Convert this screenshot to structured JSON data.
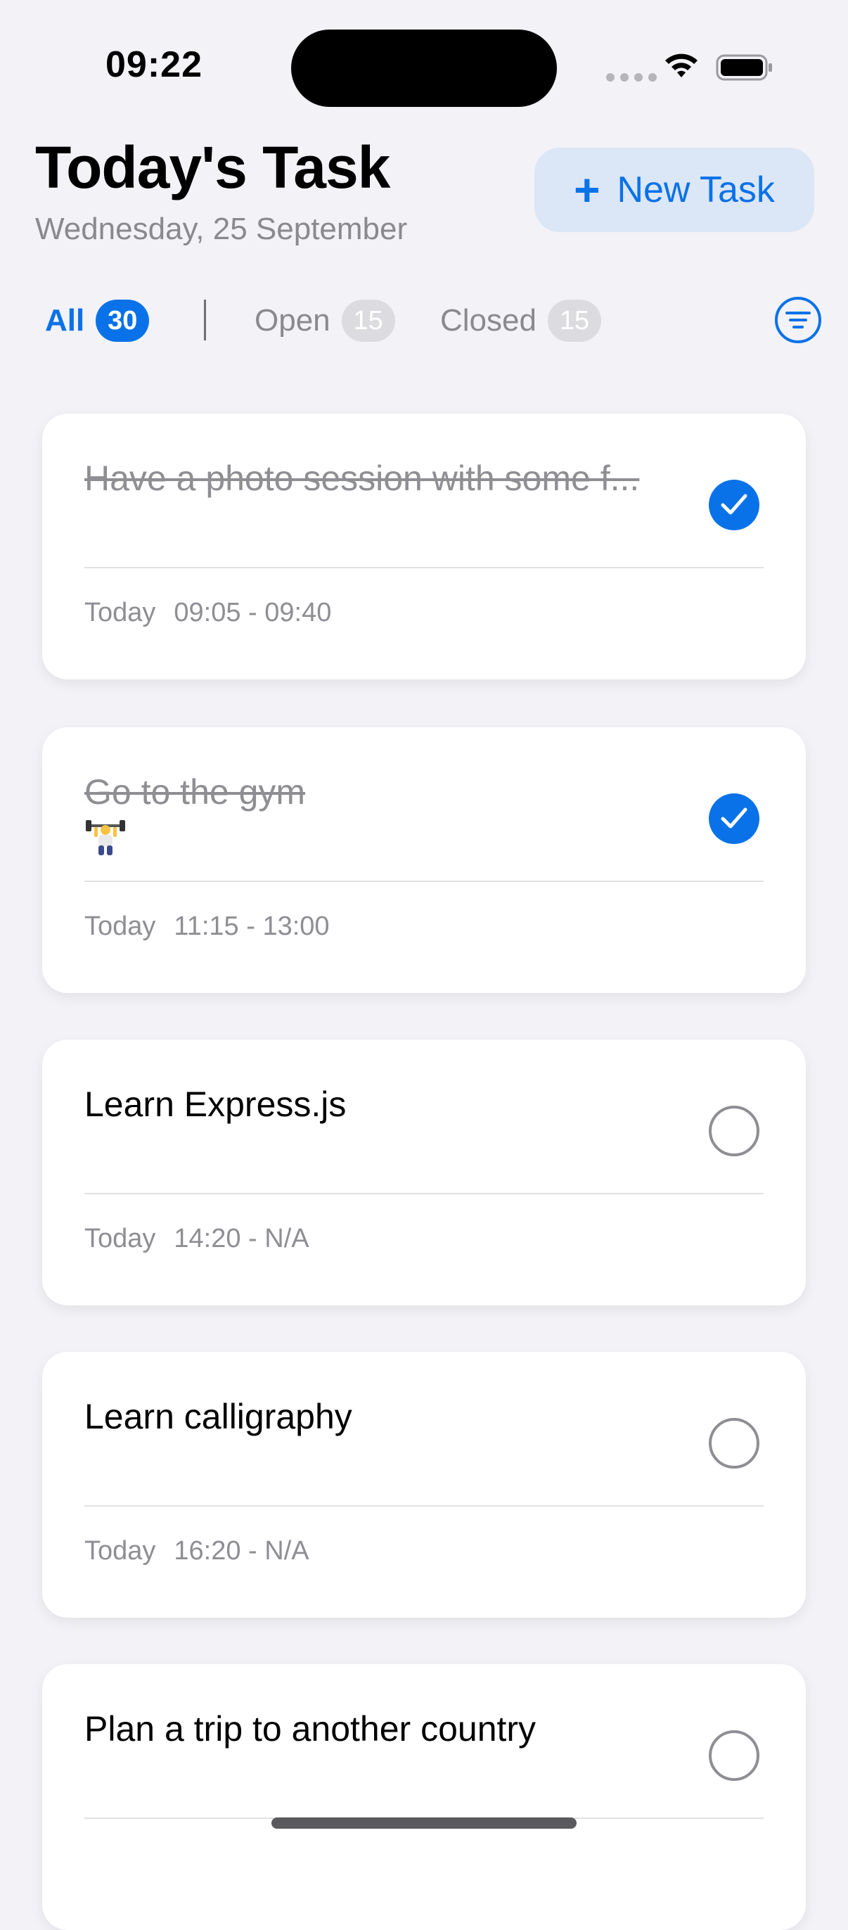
{
  "status_bar": {
    "time": "09:22"
  },
  "header": {
    "title": "Today's Task",
    "date": "Wednesday, 25 September",
    "new_task_label": "New Task"
  },
  "tabs": [
    {
      "label": "All",
      "count": "30",
      "active": true
    },
    {
      "label": "Open",
      "count": "15",
      "active": false
    },
    {
      "label": "Closed",
      "count": "15",
      "active": false
    }
  ],
  "tasks": [
    {
      "title": "Have a photo session with some f...",
      "emoji": "weightlifter",
      "day": "Today",
      "time": "09:05 - 09:40",
      "done": true
    },
    {
      "title": "Go to the gym",
      "emoji": "🏋️",
      "day": "Today",
      "time": "11:15 - 13:00",
      "done": true
    },
    {
      "title": "Learn Express.js",
      "day": "Today",
      "time": "14:20 - N/A",
      "done": false
    },
    {
      "title": "Learn calligraphy",
      "day": "Today",
      "time": "16:20 - N/A",
      "done": false
    },
    {
      "title": "Plan a trip to another country",
      "day": "",
      "time": "",
      "done": false
    }
  ],
  "colors": {
    "accent": "#0a72e8",
    "background": "#f2f2f7",
    "muted": "#8e8e93"
  },
  "icons": [
    "plus-icon",
    "filter-icon",
    "checkmark-icon",
    "wifi-icon",
    "battery-icon",
    "weightlifter-emoji"
  ]
}
